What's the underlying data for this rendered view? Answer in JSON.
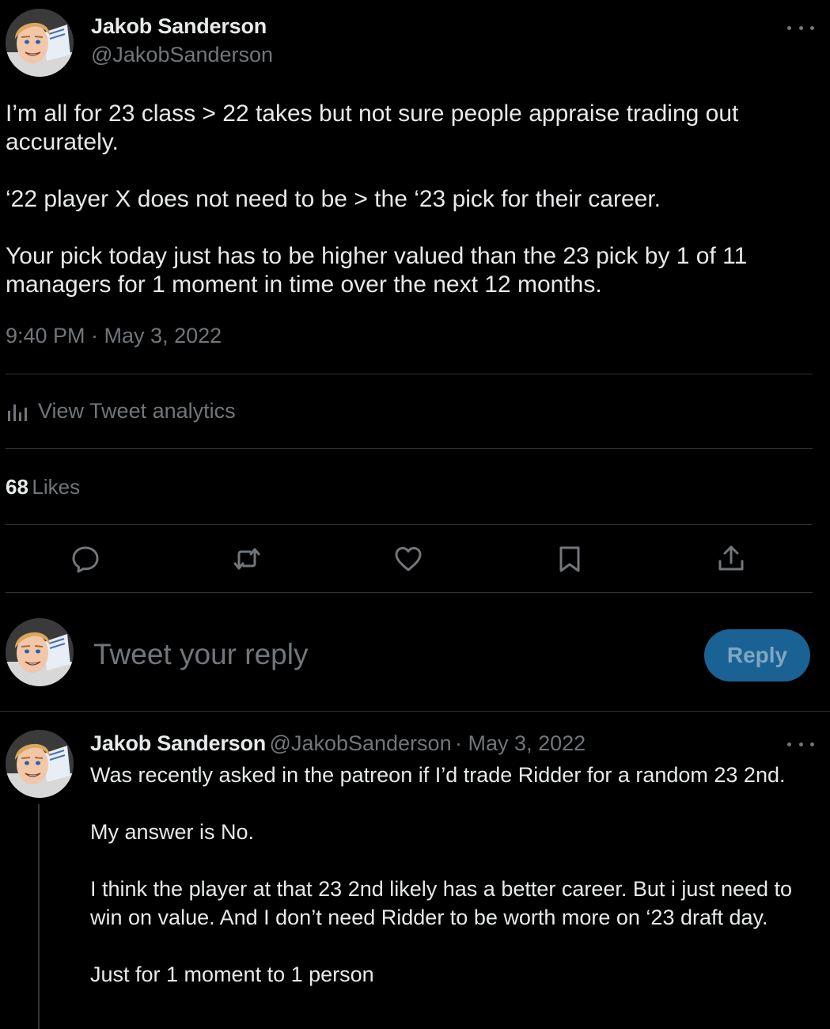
{
  "main_tweet": {
    "author_name": "Jakob Sanderson",
    "author_handle": "@JakobSanderson",
    "paragraphs": [
      "I’m all for 23 class > 22 takes but not sure people appraise trading out accurately.",
      "‘22 player X does not need to be > the ‘23 pick for their career.",
      "Your pick today just has to be higher valued than the 23 pick by 1 of 11 managers for 1 moment in time over the next 12 months."
    ],
    "timestamp": "9:40 PM · May 3, 2022",
    "analytics_label": "View Tweet analytics",
    "likes_count": "68",
    "likes_label": "Likes",
    "actions": [
      "reply-icon",
      "retweet-icon",
      "like-icon",
      "bookmark-icon",
      "share-icon"
    ]
  },
  "composer": {
    "placeholder": "Tweet your reply",
    "button_label": "Reply"
  },
  "reply_tweet": {
    "author_name": "Jakob Sanderson",
    "author_handle": "@JakobSanderson",
    "date": "· May 3, 2022",
    "paragraphs": [
      "Was recently asked in the patreon if I’d trade Ridder for a random 23 2nd.",
      "My answer is No.",
      "I think the player at that 23 2nd likely has a better career. But i just need to win on value. And I don’t need Ridder to be worth more on ‘23 draft day.",
      "Just for 1 moment to 1 person"
    ]
  },
  "colors": {
    "background": "#000000",
    "text_primary": "#e7e9ea",
    "text_secondary": "#71767b",
    "divider": "#2f3336",
    "reply_button_bg": "#1a6294"
  }
}
